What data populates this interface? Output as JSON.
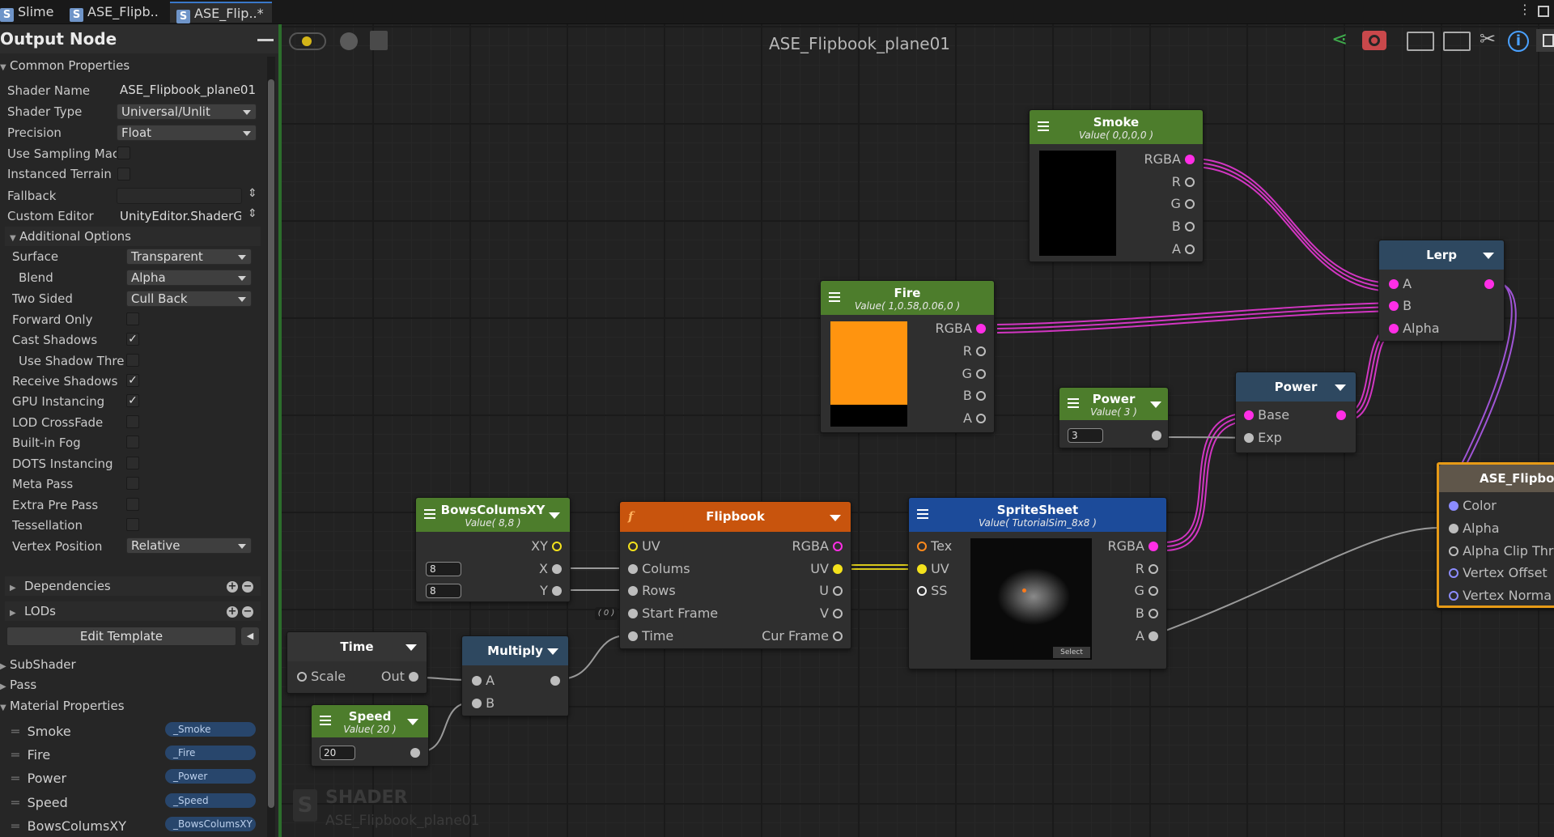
{
  "tabs": [
    "Slime",
    "ASE_Flipb..",
    "ASE_Flip..*"
  ],
  "panel": {
    "title": "Output Node",
    "common_properties": "Common Properties"
  },
  "props": {
    "shader_name_label": "Shader Name",
    "shader_name": "ASE_Flipbook_plane01",
    "shader_type_label": "Shader Type",
    "shader_type": "Universal/Unlit",
    "precision_label": "Precision",
    "precision": "Float",
    "use_sampling_label": "Use Sampling Mac",
    "instanced_terrain_label": "Instanced Terrain",
    "fallback_label": "Fallback",
    "custom_editor_label": "Custom Editor",
    "custom_editor": "UnityEditor.ShaderG"
  },
  "additional": {
    "title": "Additional Options",
    "surface_label": "Surface",
    "surface": "Transparent",
    "blend_label": "Blend",
    "blend": "Alpha",
    "two_sided_label": "Two Sided",
    "two_sided": "Cull Back",
    "forward_only": "Forward Only",
    "cast_shadows": "Cast Shadows",
    "use_shadow": "Use Shadow Thre",
    "receive_shadows": "Receive Shadows",
    "gpu_instancing": "GPU Instancing",
    "lod_crossfade": "LOD CrossFade",
    "builtin_fog": "Built-in Fog",
    "dots_instancing": "DOTS Instancing",
    "meta_pass": "Meta Pass",
    "extra_pre_pass": "Extra Pre Pass",
    "tessellation": "Tessellation",
    "vertex_position_label": "Vertex Position",
    "vertex_position": "Relative",
    "check": "✓"
  },
  "sections": {
    "dependencies": "Dependencies",
    "lods": "LODs",
    "edit_template": "Edit Template",
    "subshader": "SubShader",
    "pass": "Pass",
    "material_properties": "Material Properties"
  },
  "material": [
    {
      "name": "Smoke",
      "ref": "_Smoke"
    },
    {
      "name": "Fire",
      "ref": "_Fire"
    },
    {
      "name": "Power",
      "ref": "_Power"
    },
    {
      "name": "Speed",
      "ref": "_Speed"
    },
    {
      "name": "BowsColumsXY",
      "ref": "_BowsColumsXY"
    }
  ],
  "graph": {
    "title": "ASE_Flipbook_plane01",
    "watermark": "SHADER",
    "watermark_sub": "ASE_Flipbook_plane01"
  },
  "nodes": {
    "smoke": {
      "title": "Smoke",
      "sub": "Value( 0,0,0,0 )",
      "color": "#000000"
    },
    "fire": {
      "title": "Fire",
      "sub": "Value( 1,0.58,0.06,0 )",
      "color": "#ff940f"
    },
    "power_const": {
      "title": "Power",
      "sub": "Value( 3 )",
      "value": "3"
    },
    "power": {
      "title": "Power",
      "base": "Base",
      "exp": "Exp"
    },
    "lerp": {
      "title": "Lerp",
      "a": "A",
      "b": "B",
      "alpha": "Alpha"
    },
    "bows": {
      "title": "BowsColumsXY",
      "sub": "Value( 8,8 )",
      "xy": "XY",
      "x": "X",
      "y": "Y",
      "vx": "8",
      "vy": "8"
    },
    "flipbook": {
      "title": "Flipbook",
      "uv": "UV",
      "colums": "Colums",
      "rows": "Rows",
      "start": "Start Frame",
      "time": "Time",
      "rgba": "RGBA",
      "uv_out": "UV",
      "u": "U",
      "v": "V",
      "cur": "Cur Frame",
      "zero": "( 0 )"
    },
    "sprite": {
      "title": "SpriteSheet",
      "sub": "Value( TutorialSim_8x8 )",
      "tex": "Tex",
      "uv": "UV",
      "ss": "SS",
      "rgba": "RGBA",
      "r": "R",
      "g": "G",
      "b": "B",
      "a": "A",
      "select": "Select"
    },
    "time": {
      "title": "Time",
      "scale": "Scale",
      "out": "Out"
    },
    "multiply": {
      "title": "Multiply",
      "a": "A",
      "b": "B"
    },
    "speed": {
      "title": "Speed",
      "sub": "Value( 20 )",
      "value": "20"
    },
    "output": {
      "title": "ASE_Flipboo",
      "color": "Color",
      "alpha": "Alpha",
      "clip": "Alpha Clip Thr",
      "offset": "Vertex Offset",
      "normal": "Vertex Norma"
    }
  },
  "channels": {
    "rgba": "RGBA",
    "r": "R",
    "g": "G",
    "b": "B",
    "a": "A"
  }
}
